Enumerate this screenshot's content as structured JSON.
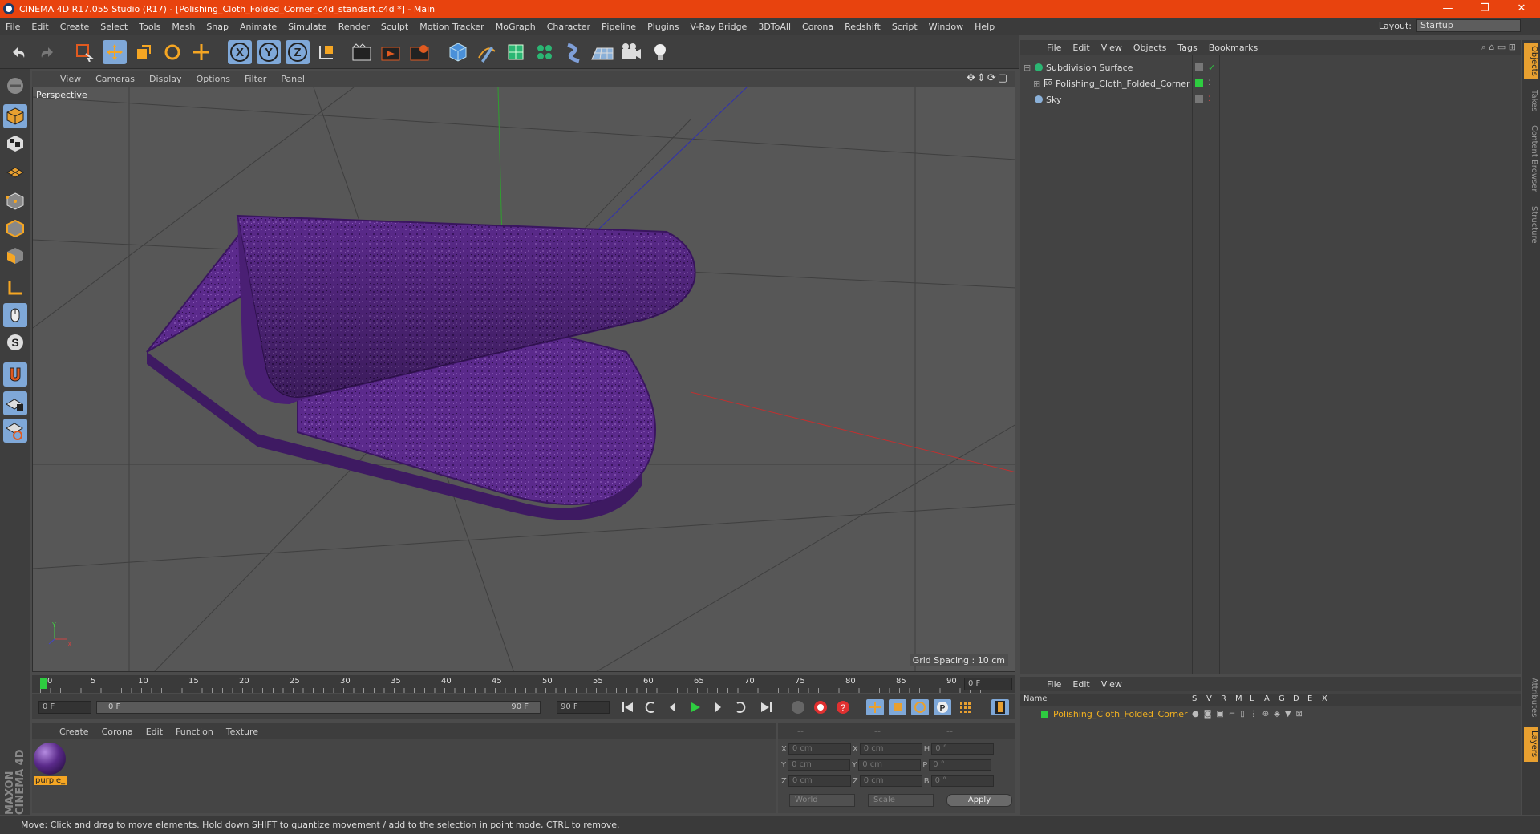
{
  "window": {
    "title": "CINEMA 4D R17.055 Studio (R17) - [Polishing_Cloth_Folded_Corner_c4d_standart.c4d *] - Main",
    "controls": [
      "—",
      "❐",
      "✕"
    ]
  },
  "menubar": {
    "items": [
      "File",
      "Edit",
      "Create",
      "Select",
      "Tools",
      "Mesh",
      "Snap",
      "Animate",
      "Simulate",
      "Render",
      "Sculpt",
      "Motion Tracker",
      "MoGraph",
      "Character",
      "Pipeline",
      "Plugins",
      "V-Ray Bridge",
      "3DToAll",
      "Corona",
      "Redshift",
      "Script",
      "Window",
      "Help"
    ],
    "layout_label": "Layout:",
    "layout_value": "Startup"
  },
  "viewport": {
    "menu": [
      "View",
      "Cameras",
      "Display",
      "Options",
      "Filter",
      "Panel"
    ],
    "camera_label": "Perspective",
    "grid_spacing": "Grid Spacing : 10 cm",
    "axis_labels": {
      "y": "Y",
      "x": "X"
    }
  },
  "timeline": {
    "ticks": [
      "0",
      "5",
      "10",
      "15",
      "20",
      "25",
      "30",
      "35",
      "40",
      "45",
      "50",
      "55",
      "60",
      "65",
      "70",
      "75",
      "80",
      "85",
      "90"
    ],
    "current_frame_field": "0 F",
    "start_field": "0 F",
    "range_start": "0 F",
    "range_end": "90 F",
    "end_field": "90 F",
    "current_frame": 0
  },
  "material_panel": {
    "menu": [
      "Create",
      "Corona",
      "Edit",
      "Function",
      "Texture"
    ],
    "materials": [
      {
        "name": "purple_",
        "color": "#5a2a8a"
      }
    ]
  },
  "coords_panel": {
    "headers": [
      "--",
      "--",
      "--"
    ],
    "rows": [
      {
        "a": "X",
        "a_val": "0 cm",
        "b": "X",
        "b_val": "0 cm",
        "c": "H",
        "c_val": "0 °"
      },
      {
        "a": "Y",
        "a_val": "0 cm",
        "b": "Y",
        "b_val": "0 cm",
        "c": "P",
        "c_val": "0 °"
      },
      {
        "a": "Z",
        "a_val": "0 cm",
        "b": "Z",
        "b_val": "0 cm",
        "c": "B",
        "c_val": "0 °"
      }
    ],
    "space": "World",
    "mode": "Scale",
    "apply": "Apply"
  },
  "object_manager": {
    "menu": [
      "File",
      "Edit",
      "View",
      "Objects",
      "Tags",
      "Bookmarks"
    ],
    "objects": [
      {
        "name": "Subdivision Surface",
        "indent": 0
      },
      {
        "name": "Polishing_Cloth_Folded_Corner",
        "indent": 1
      },
      {
        "name": "Sky",
        "indent": 0
      }
    ]
  },
  "layer_manager": {
    "menu": [
      "File",
      "Edit",
      "View"
    ],
    "columns": [
      "Name",
      "S",
      "V",
      "R",
      "M",
      "L",
      "A",
      "G",
      "D",
      "E",
      "X"
    ],
    "layers": [
      {
        "name": "Polishing_Cloth_Folded_Corner",
        "color": "#2ecc40"
      }
    ]
  },
  "right_tabs": [
    "Objects",
    "Takes",
    "Content Browser",
    "Structure",
    "Attributes",
    "Layers"
  ],
  "brand": "MAXON CINEMA 4D",
  "statusbar": {
    "text": "Move: Click and drag to move elements. Hold down SHIFT to quantize movement / add to the selection in point mode, CTRL to remove."
  },
  "colors": {
    "titlebar": "#e8430e",
    "accent": "#7fa8d8",
    "cloth": "#5b2a8c",
    "layer_name": "#f0b020"
  }
}
